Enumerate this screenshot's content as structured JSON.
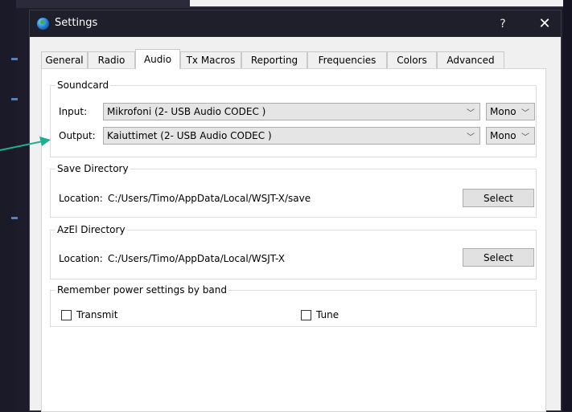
{
  "window": {
    "title": "Settings",
    "help_label": "?",
    "close_label": "✕"
  },
  "tabs": [
    {
      "label": "General",
      "active": false
    },
    {
      "label": "Radio",
      "active": false
    },
    {
      "label": "Audio",
      "active": true
    },
    {
      "label": "Tx Macros",
      "active": false
    },
    {
      "label": "Reporting",
      "active": false
    },
    {
      "label": "Frequencies",
      "active": false
    },
    {
      "label": "Colors",
      "active": false
    },
    {
      "label": "Advanced",
      "active": false
    }
  ],
  "soundcard": {
    "title": "Soundcard",
    "input_label": "Input:",
    "input_value": "Mikrofoni (2- USB Audio CODEC )",
    "input_channel": "Mono",
    "output_label": "Output:",
    "output_value": "Kaiuttimet (2- USB Audio CODEC )",
    "output_channel": "Mono"
  },
  "save_directory": {
    "title": "Save Directory",
    "location_label": "Location:",
    "location_value": "C:/Users/Timo/AppData/Local/WSJT-X/save",
    "button_label": "Select"
  },
  "azel_directory": {
    "title": "AzEl Directory",
    "location_label": "Location:",
    "location_value": "C:/Users/Timo/AppData/Local/WSJT-X",
    "button_label": "Select"
  },
  "power_settings": {
    "title": "Remember power settings by band",
    "transmit_label": "Transmit",
    "transmit_checked": false,
    "tune_label": "Tune",
    "tune_checked": false
  },
  "colors": {
    "annotation_arrow": "#1fae8f",
    "titlebar": "#1f1f2c"
  }
}
